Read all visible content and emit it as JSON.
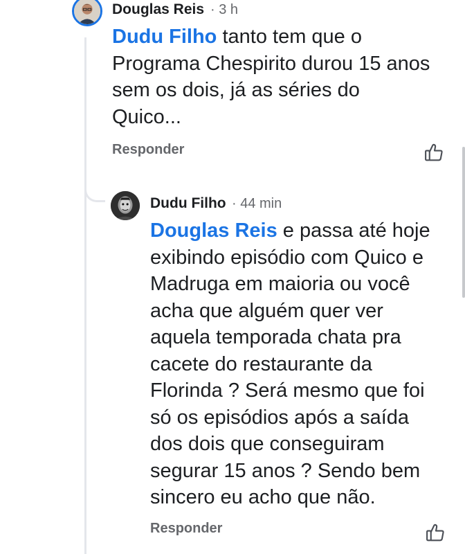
{
  "comments": [
    {
      "author": "Douglas Reis",
      "time": "· 3 h",
      "mention": "Dudu Filho",
      "text": " tanto tem que o Programa Chespirito durou 15 anos sem os dois, já as séries do Quico...",
      "reply_label": "Responder",
      "avatar_icon": "user-avatar-photo",
      "like_icon": "thumbs-up-icon"
    },
    {
      "author": "Dudu Filho",
      "time": "· 44 min",
      "mention": "Douglas Reis",
      "text": " e passa até hoje exibindo episódio com Quico e Madruga em maioria ou você acha que alguém quer ver aquela temporada chata pra cacete do restaurante da Florinda ? Será mesmo que foi só os episódios após a saída dos dois que conseguiram segurar 15 anos ? Sendo bem sincero eu acho que não.",
      "reply_label": "Responder",
      "avatar_icon": "user-avatar-photo",
      "like_icon": "thumbs-up-icon"
    }
  ],
  "colors": {
    "mention": "#1b74e4",
    "secondary_text": "#65676b",
    "thread_line": "#e4e6eb",
    "avatar_ring": "#1b74e4"
  }
}
